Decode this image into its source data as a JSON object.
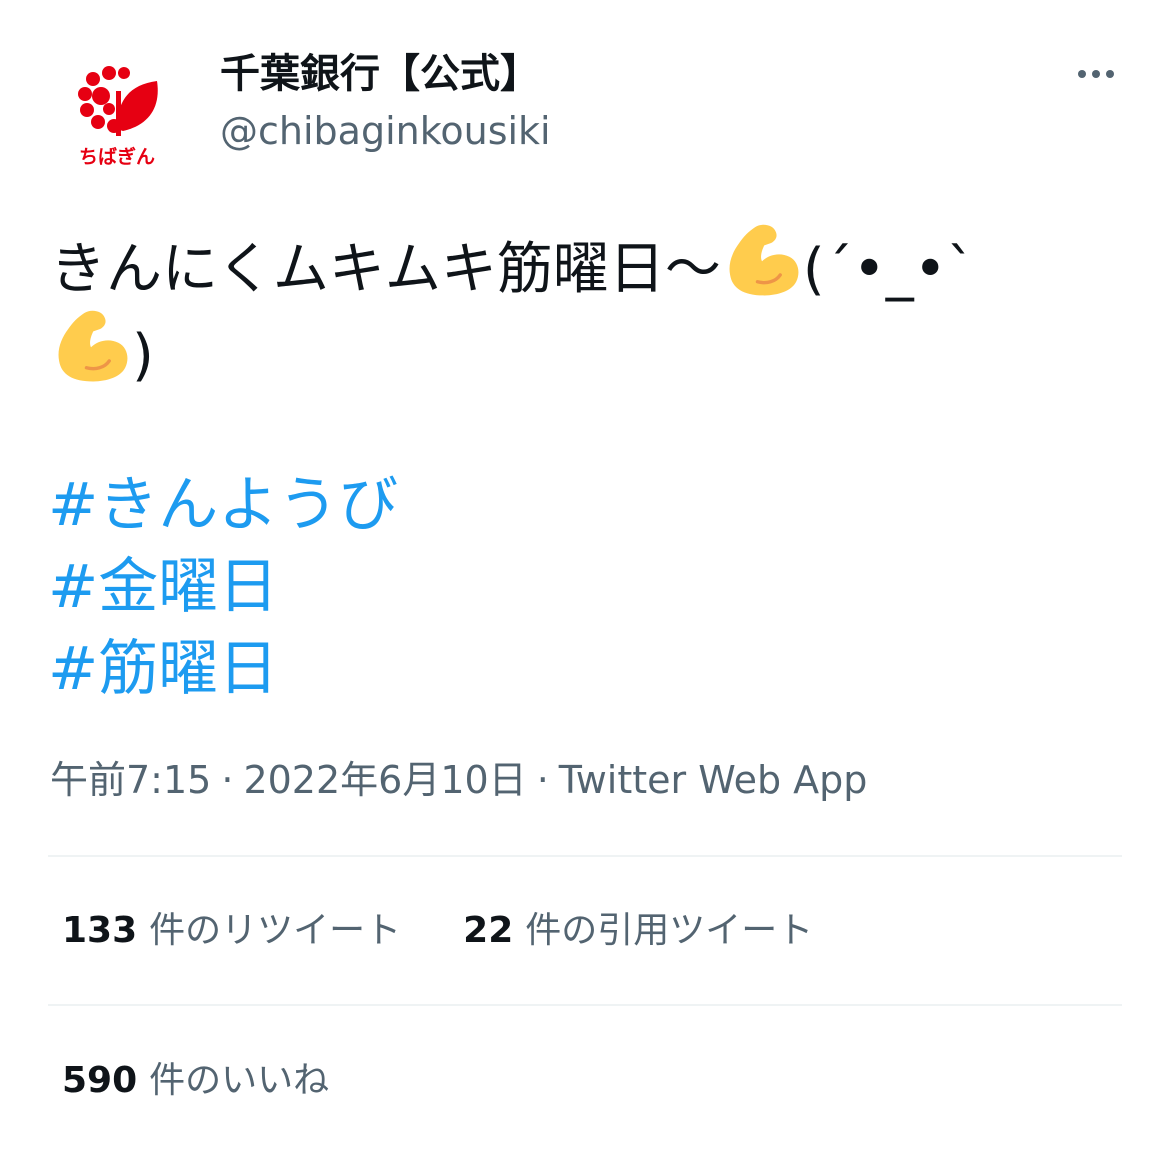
{
  "author": {
    "display_name": "千葉銀行【公式】",
    "handle": "@chibaginkousiki",
    "avatar_logo_text": "ちばぎん",
    "avatar_brand_color": "#e60012"
  },
  "tweet": {
    "text_line1_a": "きんにくムキムキ筋曜日〜",
    "text_line1_b": "(´•_•`",
    "text_line2_b": ")",
    "emoji": "flexed-biceps-icon",
    "hashtags": [
      "#きんようび",
      "#金曜日",
      "#筋曜日"
    ],
    "hashtag_color": "#1d9bf0"
  },
  "meta": {
    "time": "午前7:15",
    "separator": "·",
    "date": "2022年6月10日",
    "source": "Twitter Web App"
  },
  "stats": {
    "retweets": {
      "count": "133",
      "label": "件のリツイート"
    },
    "quotes": {
      "count": "22",
      "label": "件の引用ツイート"
    },
    "likes": {
      "count": "590",
      "label": "件のいいね"
    }
  },
  "icons": {
    "more": "more-dots-icon"
  }
}
